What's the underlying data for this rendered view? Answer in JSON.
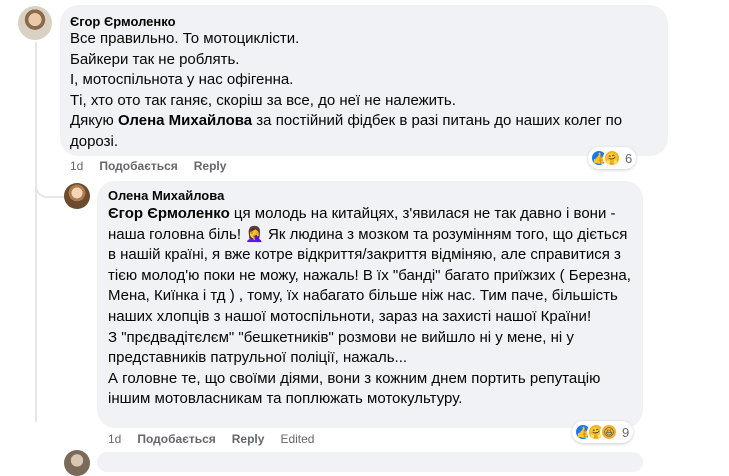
{
  "comments": [
    {
      "author": "Єгор Єрмоленко",
      "lines": [
        "Все правильно. То мотоциклісти.",
        "Байкери так не роблять.",
        "І, мотоспільнота у нас офігенна.",
        "Ті, хто ото так ганяє, скоріш за все, до неї не належить."
      ],
      "thanks_prefix": "Дякую ",
      "thanks_mention": "Олена Михайлова",
      "thanks_rest": " за постійний фідбек в разі питань до наших колег по",
      "thanks_end": "дорозі.",
      "time": "1d",
      "like_label": "Подобається",
      "reply_label": "Reply",
      "reaction_count": "6",
      "reaction_icons": [
        "like-icon",
        "care-icon"
      ]
    },
    {
      "author": "Олена Михайлова",
      "mention": "Єгор Єрмоленко",
      "p1_rest": " ця молодь на китайцях, з'явилася не так давно і вони - наша головна біль! 🤦‍♀️ Як людина з мозком та розумінням того, що діється в нашій країні, я вже котре відкриття/закриття відміняю, але справитися з тією молод'ю поки не можу, нажаль! В їх \"банді\" багато приїжзих ( Березна, Мена, Киїнка і тд ) , тому, їх набагато більше ніж нас. Тим паче, більшість наших хлопців з нашої мотоспільноти, зараз на захисті нашої Країни!",
      "p2": "З \"прєдвадітєлєм\" \"бешкетників\" розмови не вийшло ні у мене, ні у представників патрульної поліції, нажаль...",
      "p3": "А головне те, що своїми діями, вони з кожним днем портить репутацію іншим мотовласникам та поплюжать мотокультуру.",
      "time": "1d",
      "like_label": "Подобається",
      "reply_label": "Reply",
      "edited_label": "Edited",
      "reaction_count": "9",
      "reaction_icons": [
        "like-icon",
        "care-icon",
        "haha-icon"
      ]
    }
  ]
}
